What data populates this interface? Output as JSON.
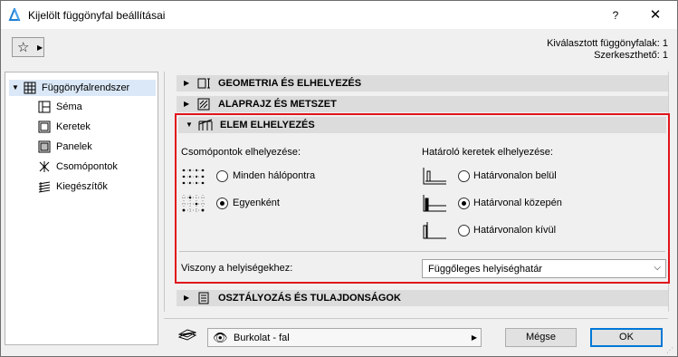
{
  "window": {
    "title": "Kijelölt függönyfal beállításai",
    "help_label": "?",
    "close_label": "✕"
  },
  "toolbar": {
    "favorites_icon": "star-icon"
  },
  "info": {
    "selected_count": "Kiválasztott függönyfalak: 1",
    "editable_count": "Szerkeszthető: 1"
  },
  "sidebar": {
    "root": {
      "label": "Függönyfalrendszer",
      "icon": "curtain-wall-system-icon"
    },
    "items": [
      {
        "label": "Séma",
        "icon": "scheme-icon"
      },
      {
        "label": "Keretek",
        "icon": "frames-icon"
      },
      {
        "label": "Panelek",
        "icon": "panels-icon"
      },
      {
        "label": "Csomópontok",
        "icon": "junctions-icon"
      },
      {
        "label": "Kiegészítők",
        "icon": "accessories-icon"
      }
    ]
  },
  "panels": {
    "geometry": {
      "label": "GEOMETRIA ÉS ELHELYEZÉS",
      "icon": "geometry-icon",
      "expanded": false
    },
    "floorplan": {
      "label": "ALAPRAJZ ÉS METSZET",
      "icon": "floorplan-section-icon",
      "expanded": false
    },
    "element": {
      "label": "ELEM ELHELYEZÉS",
      "icon": "element-placement-icon",
      "expanded": true
    },
    "classification": {
      "label": "OSZTÁLYOZÁS ÉS TULAJDONSÁGOK",
      "icon": "classification-icon",
      "expanded": false
    }
  },
  "element_placement": {
    "junctions_heading": "Csomópontok elhelyezése:",
    "junction_options": [
      {
        "label": "Minden hálópontra",
        "selected": false
      },
      {
        "label": "Egyenként",
        "selected": true
      }
    ],
    "boundary_heading": "Határoló keretek elhelyezése:",
    "boundary_options": [
      {
        "label": "Határvonalon belül",
        "selected": false
      },
      {
        "label": "Határvonal közepén",
        "selected": true
      },
      {
        "label": "Határvonalon kívül",
        "selected": false
      }
    ],
    "zone_relation_label": "Viszony a helyiségekhez:",
    "zone_relation_value": "Függőleges helyiséghatár"
  },
  "footer": {
    "layer_value": "Burkolat - fal",
    "cancel_label": "Mégse",
    "ok_label": "OK"
  },
  "colors": {
    "highlight_frame": "#e0151b",
    "tree_selection": "#dbe8f7",
    "default_button_border": "#0078d7"
  }
}
